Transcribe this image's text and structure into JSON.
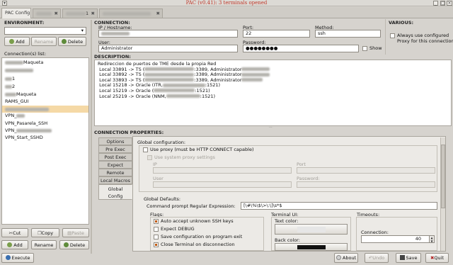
{
  "window": {
    "title": "PAC (v0.41): 3 terminals opened"
  },
  "tabs": [
    {
      "label": "PAC Config"
    },
    {
      "label": "",
      "close": "✖"
    },
    {
      "label": "1",
      "close": "✖"
    },
    {
      "label": "",
      "close": "✖"
    }
  ],
  "environment": {
    "label": "ENVIRONMENT:",
    "add_label": "Add",
    "rename_label": "Rename",
    "delete_label": "Delete"
  },
  "connections": {
    "label": "Connection(s) list:",
    "items": [
      "Maqueta",
      "",
      "1",
      "2",
      "Maqueta",
      "RAMS_GUI",
      "",
      "VPN_",
      "VPN_Pasarela_SSH",
      "VPN_",
      "VPN_Start_SSHD"
    ],
    "cut_label": "Cut",
    "copy_label": "Copy",
    "paste_label": "Paste",
    "add_label": "Add",
    "rename_label": "Rename",
    "delete_label": "Delete"
  },
  "execute_label": "Execute",
  "connection": {
    "label": "CONNECTION:",
    "ip_label": "IP / Hostname:",
    "ip_value": "",
    "port_label": "Port:",
    "port_value": "22",
    "method_label": "Method:",
    "method_value": "ssh",
    "user_label": "User:",
    "user_value": "Administrator",
    "password_label": "Password:",
    "password_value": "●●●●●●●●",
    "show_label": "Show"
  },
  "various": {
    "label": "VARIOUS:",
    "proxy_label_1": "Always use configured",
    "proxy_label_2": "Proxy for this connection"
  },
  "description": {
    "label": "DESCRIPTION:",
    "lines": [
      "Redireccion de puertos de TME desde la propia Red",
      "Local 33891 -> TS (",
      "Local 33892 -> TS (",
      "Local 33893 -> TS (",
      "Local 15218 -> Oracle (ITR,",
      "Local 15219 -> Oracle (",
      "Local 25219 -> Oracle (NNM,"
    ],
    "line_tails": [
      "",
      ":3389, Administrator",
      ":3389, Administrator",
      ":3389, Administrator",
      ":1521)",
      ":1521)",
      ":1521)"
    ]
  },
  "properties": {
    "label": "CONNECTION PROPERTIES:",
    "vtabs": [
      "Options",
      "Pre Exec",
      "Post Exec",
      "Expect",
      "Remote Macros",
      "Local Macros",
      "Global Config"
    ],
    "global_config_label": "Global configuration:",
    "use_proxy_label": "Use proxy (must be HTTP CONNECT capable)",
    "use_system_proxy_label": "Use system proxy settings",
    "ip_label": "IP",
    "port_label": "Port",
    "user_label": "User",
    "password_label": "Password:",
    "global_defaults_label": "Global Defaults:",
    "prompt_label": "Command prompt Regular Expression:",
    "prompt_value": "[\\#\\%\\$\\>\\:\\]\\s*$",
    "flags_label": "Flags:",
    "flags": [
      {
        "label": "Auto accept unknown SSH keys",
        "checked": true
      },
      {
        "label": "Expect DEBUG",
        "checked": false
      },
      {
        "label": "Save configuration on program exit",
        "checked": false
      },
      {
        "label": "Close Terminal on disconnection",
        "checked": true
      }
    ],
    "terminal_ui_label": "Terminal UI:",
    "text_color_label": "Text color:",
    "back_color_label": "Back color:",
    "timeouts_label": "Timeouts:",
    "connection_label": "Connection:",
    "connection_value": "40"
  },
  "bottom": {
    "about_label": "About",
    "undo_label": "Undo",
    "save_label": "Save",
    "quit_label": "Quit"
  },
  "colors": {
    "accent": "#f5d9a6",
    "title": "#c0392b"
  }
}
